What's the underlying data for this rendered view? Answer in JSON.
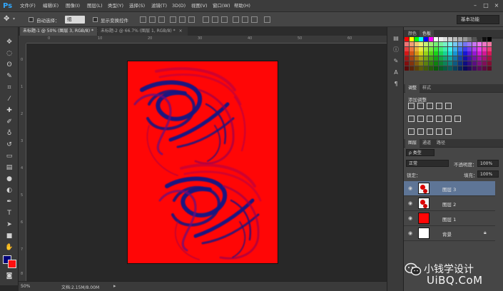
{
  "app": {
    "logo": "Ps"
  },
  "menu": [
    "文件(F)",
    "编辑(E)",
    "图像(I)",
    "图层(L)",
    "类型(Y)",
    "选择(S)",
    "滤镜(T)",
    "3D(D)",
    "视图(V)",
    "窗口(W)",
    "帮助(H)"
  ],
  "window_controls": {
    "minimize": "–",
    "maximize": "□",
    "close": "×"
  },
  "options": {
    "auto_select_label": "自动选择：",
    "auto_select_value": "组",
    "show_transform_label": "显示变换控件",
    "workspace": "基本功能"
  },
  "tabs": [
    {
      "label": "未标题-1 @ 50% (图层 3, RGB/8) *",
      "close": "×",
      "active": true
    },
    {
      "label": "未标题-2 @ 66.7% (图层 1, RGB/8) *",
      "close": "×",
      "active": false
    }
  ],
  "rulers": {
    "top": [
      "0",
      "10",
      "20",
      "30",
      "40",
      "50",
      "60"
    ],
    "left": [
      "0",
      "1",
      "2",
      "3",
      "4",
      "5",
      "6",
      "7",
      "8"
    ]
  },
  "status": {
    "zoom": "50%",
    "doc_info": "文档:2.15M/8.00M"
  },
  "panels": {
    "color_tabs": [
      "颜色",
      "色板"
    ],
    "adjust_tabs": [
      "调整",
      "样式"
    ],
    "adjust_add_label": "添加调整",
    "layer_tabs": [
      "图层",
      "通道",
      "路径"
    ],
    "filter_kind": "ρ 类型",
    "blend_mode": "正常",
    "opacity_label": "不透明度：",
    "opacity_value": "100%",
    "lock_label": "锁定：",
    "fill_label": "填充：",
    "fill_value": "100%"
  },
  "layers": [
    {
      "name": "图层 3",
      "selected": true,
      "thumb": "marble-dots"
    },
    {
      "name": "图层 2",
      "selected": false,
      "thumb": "marble-dots"
    },
    {
      "name": "图层 1",
      "selected": false,
      "thumb": "red"
    },
    {
      "name": "背景",
      "selected": false,
      "thumb": "white",
      "locked": true
    }
  ],
  "watermark": {
    "text": "小钱学设计",
    "site": "UiBQ.CoM"
  },
  "colors": {
    "canvas_red": "#ff0606",
    "swirl_blue": "#1a1480",
    "foreground": "#00007a",
    "background": "#ff1010",
    "selected_layer": "#5e7596"
  }
}
